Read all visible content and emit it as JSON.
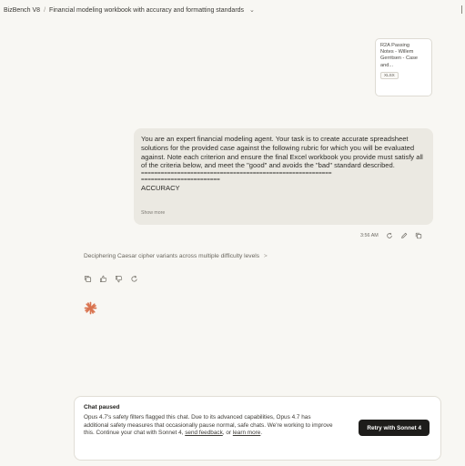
{
  "header": {
    "project": "BizBench V8",
    "separator": "/",
    "chat_title": "Financial modeling workbook with accuracy and formatting standards"
  },
  "attachment": {
    "name": "R2A Passing\nNotes - Willem\nGerritsen - Case\nand...",
    "type": "XLSX"
  },
  "user_message": {
    "text": "You are an expert financial modeling agent. Your task is to create accurate spreadsheet solutions for the provided case against the following rubric for which you will be evaluated against. Note each criterion and ensure the final Excel workbook you provide must satisfy all of the criteria below, and meet the \"good\" and avoids the \"bad\" standard described.",
    "separator_line_1": "==========================================================",
    "separator_line_2": "========================",
    "section": "ACCURACY",
    "show_more": "Show more",
    "time": "3:56 AM"
  },
  "assistant": {
    "thinking_summary": "Deciphering Caesar cipher variants across multiple difficulty levels",
    "thinking_chevron": ">"
  },
  "notice": {
    "title": "Chat paused",
    "body": "Opus 4.7's safety filters flagged this chat. Due to its advanced capabilities, Opus 4.7 has additional safety measures that occasionally pause normal, safe chats. We're working to improve this. Continue your chat with Sonnet 4,",
    "feedback_link": "send feedback",
    "or": ", or ",
    "learn_link": "learn more",
    "end": ".",
    "button": "Retry with Sonnet 4"
  },
  "colors": {
    "background": "#f8f7f3",
    "bubble": "#ebe9e2",
    "spark": "#d9734f",
    "button": "#1e1d1b"
  }
}
